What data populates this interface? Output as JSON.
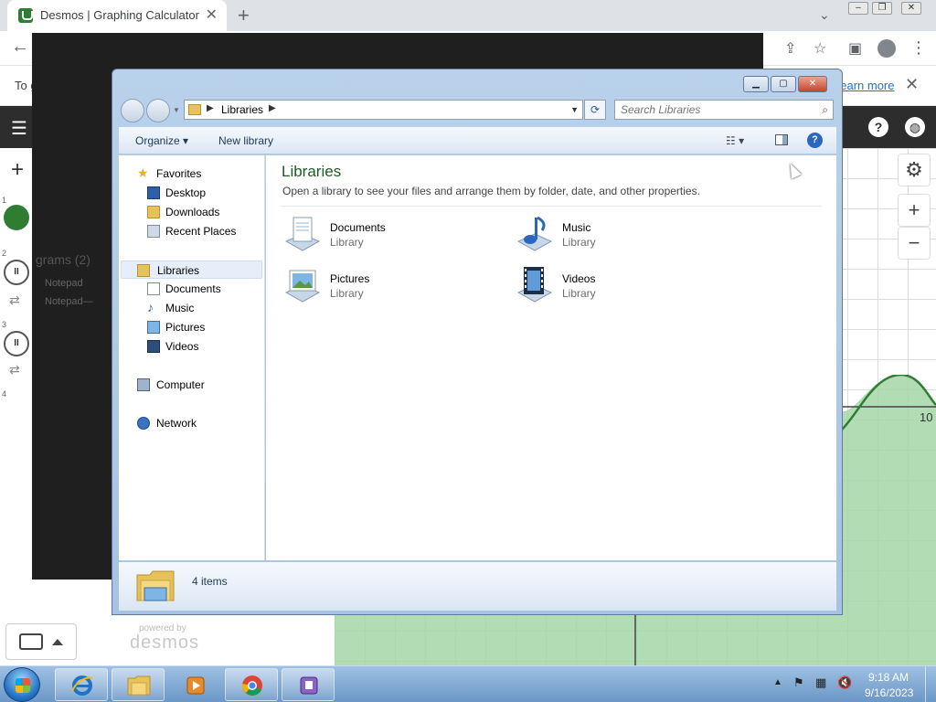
{
  "browser": {
    "tab_title": "Desmos | Graphing Calculator",
    "tab_close_glyph": "✕",
    "new_tab_glyph": "+",
    "infobar_text": "To g",
    "infobar_link": "Learn more"
  },
  "desmos": {
    "row_numbers": [
      "1",
      "2",
      "3",
      "4"
    ],
    "powered_by": "powered by",
    "logo_text": "desmos",
    "x_tick_label": "10",
    "ghost_text_1": "grams (2)",
    "ghost_text_2": "Notepad",
    "ghost_text_3": "Notepad—"
  },
  "explorer": {
    "address": {
      "crumb": "Libraries"
    },
    "search": {
      "placeholder": "Search Libraries"
    },
    "command_bar": {
      "organize": "Organize",
      "new_library": "New library"
    },
    "nav": {
      "favorites": "Favorites",
      "desktop": "Desktop",
      "downloads": "Downloads",
      "recent_places": "Recent Places",
      "libraries": "Libraries",
      "documents": "Documents",
      "music": "Music",
      "pictures": "Pictures",
      "videos": "Videos",
      "computer": "Computer",
      "network": "Network"
    },
    "content": {
      "heading": "Libraries",
      "subtitle": "Open a library to see your files and arrange them by folder, date, and other properties.",
      "libraries": [
        {
          "name": "Documents",
          "type": "Library"
        },
        {
          "name": "Music",
          "type": "Library"
        },
        {
          "name": "Pictures",
          "type": "Library"
        },
        {
          "name": "Videos",
          "type": "Library"
        }
      ]
    },
    "status": {
      "item_count": "4 items"
    }
  },
  "taskbar": {
    "time": "9:18 AM",
    "date": "9/16/2023"
  },
  "colors": {
    "explorer_frame": "#b9d1ea",
    "heading_green": "#1e5a23",
    "desmos_header": "#2d2d2d",
    "graph_fill": "#a5d6a7",
    "graph_curve": "#2e7d32",
    "taskbar": "#6b97c6"
  }
}
